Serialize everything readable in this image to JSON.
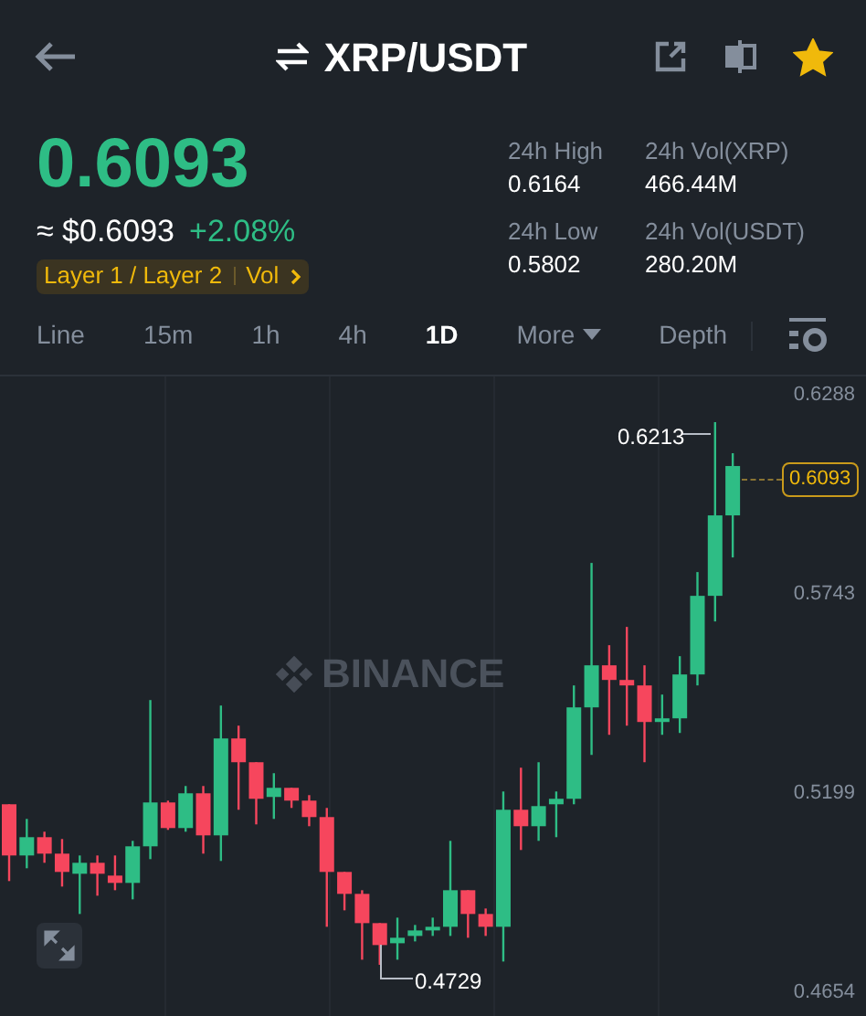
{
  "header": {
    "pair": "XRP/USDT",
    "favorite": true
  },
  "price": {
    "last": "0.6093",
    "fiat": "≈ $0.6093",
    "change": "+2.08%",
    "tags": [
      "Layer 1 / Layer 2",
      "Vol"
    ]
  },
  "stats": [
    {
      "label": "24h High",
      "value": "0.6164"
    },
    {
      "label": "24h Vol(XRP)",
      "value": "466.44M"
    },
    {
      "label": "24h Low",
      "value": "0.5802"
    },
    {
      "label": "24h Vol(USDT)",
      "value": "280.20M"
    }
  ],
  "tabs": [
    {
      "label": "Line",
      "selected": false,
      "kind": "interval"
    },
    {
      "label": "15m",
      "selected": false,
      "kind": "interval"
    },
    {
      "label": "1h",
      "selected": false,
      "kind": "interval"
    },
    {
      "label": "4h",
      "selected": false,
      "kind": "interval"
    },
    {
      "label": "1D",
      "selected": true,
      "kind": "interval"
    },
    {
      "label": "More",
      "selected": false,
      "kind": "dropdown"
    },
    {
      "label": "Depth",
      "selected": false,
      "kind": "interval"
    }
  ],
  "chart": {
    "watermark": "BINANCE",
    "high_label": "0.6213",
    "low_label": "0.4729",
    "current_price": "0.6093",
    "chart_data": {
      "type": "candlestick",
      "ylim": [
        0.4654,
        0.6288
      ],
      "yticks": [
        0.6288,
        0.5743,
        0.5199,
        0.4654
      ],
      "ohlc": [
        [
          0.5168,
          0.5168,
          0.4958,
          0.5028
        ],
        [
          0.5028,
          0.5128,
          0.4993,
          0.5078
        ],
        [
          0.5078,
          0.5093,
          0.5008,
          0.5033
        ],
        [
          0.5033,
          0.5073,
          0.4943,
          0.4983
        ],
        [
          0.4978,
          0.5028,
          0.4868,
          0.5008
        ],
        [
          0.5008,
          0.5028,
          0.4918,
          0.4978
        ],
        [
          0.4973,
          0.5028,
          0.4933,
          0.4953
        ],
        [
          0.4953,
          0.5068,
          0.4908,
          0.5053
        ],
        [
          0.5053,
          0.5453,
          0.5018,
          0.5173
        ],
        [
          0.5173,
          0.5178,
          0.5098,
          0.5103
        ],
        [
          0.5103,
          0.5218,
          0.5093,
          0.5198
        ],
        [
          0.5198,
          0.5218,
          0.5033,
          0.5083
        ],
        [
          0.5083,
          0.5438,
          0.5013,
          0.5348
        ],
        [
          0.5348,
          0.5383,
          0.5153,
          0.5283
        ],
        [
          0.5283,
          0.5283,
          0.5113,
          0.5183
        ],
        [
          0.5188,
          0.5253,
          0.5128,
          0.5213
        ],
        [
          0.5213,
          0.5213,
          0.5158,
          0.5178
        ],
        [
          0.5178,
          0.5193,
          0.5108,
          0.5133
        ],
        [
          0.5133,
          0.5158,
          0.4833,
          0.4983
        ],
        [
          0.4983,
          0.4983,
          0.4878,
          0.4923
        ],
        [
          0.4923,
          0.4933,
          0.4743,
          0.4843
        ],
        [
          0.4843,
          0.4843,
          0.4729,
          0.4783
        ],
        [
          0.4788,
          0.4858,
          0.4743,
          0.4803
        ],
        [
          0.4808,
          0.4838,
          0.4793,
          0.4823
        ],
        [
          0.4823,
          0.4858,
          0.4808,
          0.4833
        ],
        [
          0.4833,
          0.5068,
          0.4808,
          0.4933
        ],
        [
          0.4933,
          0.4933,
          0.4803,
          0.4868
        ],
        [
          0.4868,
          0.4883,
          0.4808,
          0.4833
        ],
        [
          0.4833,
          0.5203,
          0.4738,
          0.5153
        ],
        [
          0.5153,
          0.5268,
          0.5043,
          0.5108
        ],
        [
          0.5108,
          0.5283,
          0.5068,
          0.5163
        ],
        [
          0.5168,
          0.5203,
          0.5078,
          0.5183
        ],
        [
          0.5183,
          0.5493,
          0.5168,
          0.5433
        ],
        [
          0.5433,
          0.5828,
          0.5303,
          0.5548
        ],
        [
          0.5548,
          0.5603,
          0.5358,
          0.5508
        ],
        [
          0.5508,
          0.5653,
          0.5383,
          0.5493
        ],
        [
          0.5493,
          0.5548,
          0.5283,
          0.5393
        ],
        [
          0.5393,
          0.5468,
          0.5358,
          0.5403
        ],
        [
          0.5403,
          0.5573,
          0.5363,
          0.5523
        ],
        [
          0.5523,
          0.5803,
          0.5493,
          0.5738
        ],
        [
          0.5738,
          0.6213,
          0.5668,
          0.5958
        ],
        [
          0.5958,
          0.6128,
          0.5843,
          0.6093
        ]
      ]
    }
  }
}
